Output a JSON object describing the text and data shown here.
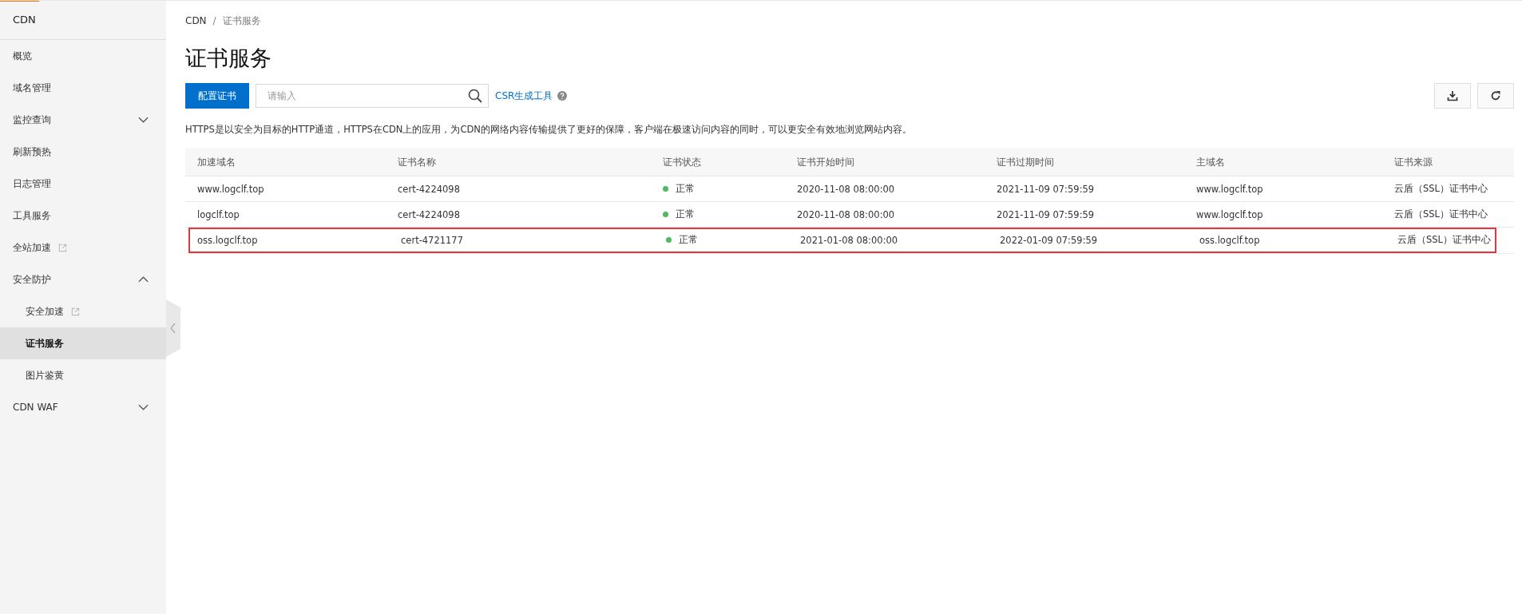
{
  "sidebar": {
    "title": "CDN",
    "items": [
      {
        "label": "概览",
        "selected": false
      },
      {
        "label": "域名管理",
        "selected": false
      },
      {
        "label": "监控查询",
        "selected": false,
        "expanded": false
      },
      {
        "label": "刷新预热",
        "selected": false
      },
      {
        "label": "日志管理",
        "selected": false
      },
      {
        "label": "工具服务",
        "selected": false
      },
      {
        "label": "全站加速",
        "selected": false,
        "external": true
      },
      {
        "label": "安全防护",
        "selected": false,
        "expanded": true,
        "children": [
          {
            "label": "安全加速",
            "selected": false,
            "external": true
          },
          {
            "label": "证书服务",
            "selected": true
          },
          {
            "label": "图片鉴黄",
            "selected": false
          }
        ]
      },
      {
        "label": "CDN WAF",
        "selected": false,
        "expanded": false
      }
    ]
  },
  "breadcrumb": [
    "CDN",
    "证书服务"
  ],
  "breadcrumb_separator": "/",
  "page_title": "证书服务",
  "toolbar": {
    "primary_button": "配置证书",
    "search": {
      "placeholder": "请输入"
    },
    "link": "CSR生成工具"
  },
  "description": "HTTPS是以安全为目标的HTTP通道，HTTPS在CDN上的应用，为CDN的网络内容传输提供了更好的保障，客户端在极速访问内容的同时，可以更安全有效地浏览网站内容。",
  "table": {
    "columns": [
      "加速域名",
      "证书名称",
      "证书状态",
      "证书开始时间",
      "证书过期时间",
      "主域名",
      "证书来源"
    ],
    "rows": [
      {
        "highlighted": false,
        "color": "#4cbb5e",
        "cells": [
          "www.logclf.top",
          "cert-4224098",
          "正常",
          "2020-11-08 08:00:00",
          "2021-11-09 07:59:59",
          "www.logclf.top",
          "云盾（SSL）证书中心"
        ]
      },
      {
        "highlighted": false,
        "color": "#4cbb5e",
        "cells": [
          "logclf.top",
          "cert-4224098",
          "正常",
          "2020-11-08 08:00:00",
          "2021-11-09 07:59:59",
          "www.logclf.top",
          "云盾（SSL）证书中心"
        ]
      },
      {
        "highlighted": true,
        "color": "#4cbb5e",
        "cells": [
          "oss.logclf.top",
          "cert-4721177",
          "正常",
          "2021-01-08 08:00:00",
          "2022-01-09 07:59:59",
          "oss.logclf.top",
          "云盾（SSL）证书中心"
        ]
      }
    ]
  }
}
